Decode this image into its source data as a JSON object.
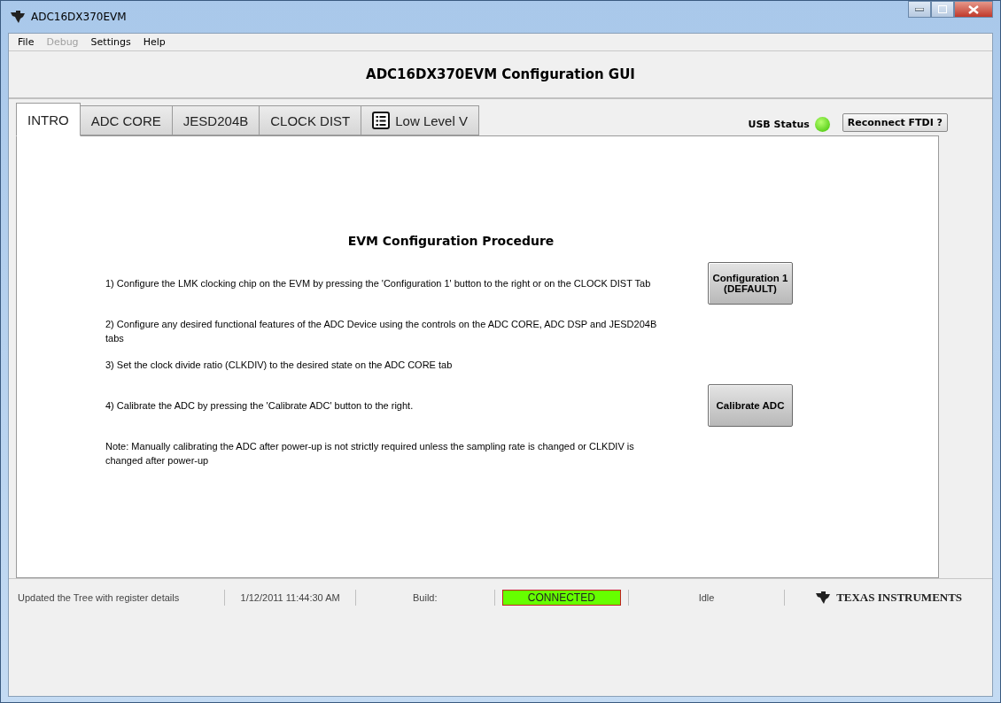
{
  "window": {
    "title": "ADC16DX370EVM"
  },
  "menu": [
    {
      "label": "File",
      "disabled": false
    },
    {
      "label": "Debug",
      "disabled": true
    },
    {
      "label": "Settings",
      "disabled": false
    },
    {
      "label": "Help",
      "disabled": false
    }
  ],
  "header": {
    "title": "ADC16DX370EVM Configuration GUI"
  },
  "tabs": [
    {
      "label": "INTRO",
      "selected": true,
      "kind": "text"
    },
    {
      "label": "ADC CORE",
      "selected": false,
      "kind": "text"
    },
    {
      "label": "JESD204B",
      "selected": false,
      "kind": "text"
    },
    {
      "label": "CLOCK DIST",
      "selected": false,
      "kind": "text"
    },
    {
      "label": "Low Level V",
      "selected": false,
      "kind": "icon"
    }
  ],
  "usb_status": {
    "label": "USB Status",
    "on": true
  },
  "reconnect_button": "Reconnect FTDI ?",
  "procedure": {
    "title": "EVM Configuration Procedure",
    "steps": [
      {
        "text": "1) Configure the LMK clocking chip on the EVM by pressing the 'Configuration 1' button to the right or on the CLOCK DIST Tab",
        "button": "Configuration 1\n(DEFAULT)"
      },
      {
        "text": "2) Configure any desired functional features of the ADC Device using the controls on the ADC CORE, ADC DSP and JESD204B tabs"
      },
      {
        "text": "3) Set the clock divide ratio (CLKDIV) to the desired state on the ADC CORE tab"
      },
      {
        "text": "4) Calibrate the ADC by pressing the 'Calibrate ADC' button to the right.",
        "button": "Calibrate ADC"
      },
      {
        "text": "Note: Manually calibrating the ADC after power-up is not strictly required unless the sampling rate is changed or CLKDIV is changed after power-up"
      }
    ]
  },
  "status_bar": [
    {
      "kind": "text",
      "text": "Updated the Tree with register details"
    },
    {
      "kind": "text",
      "text": "1/12/2011 11:44:30 AM"
    },
    {
      "kind": "text",
      "text": "Build:"
    },
    {
      "kind": "indicator",
      "text": "CONNECTED",
      "color": "#66ff00"
    },
    {
      "kind": "text",
      "text": "Idle"
    },
    {
      "kind": "logo",
      "text": "TEXAS INSTRUMENTS"
    }
  ]
}
